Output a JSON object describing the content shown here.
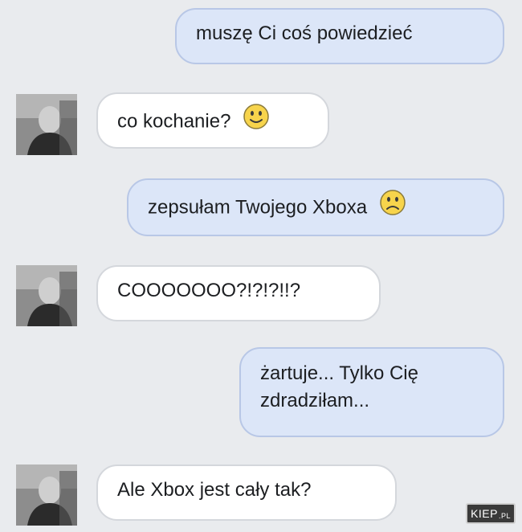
{
  "messages": [
    {
      "side": "out",
      "text": "muszę Ci coś powiedzieć",
      "emoji": ""
    },
    {
      "side": "in",
      "text": "co kochanie?",
      "emoji": "smile-emoji"
    },
    {
      "side": "out",
      "text": "zepsułam Twojego Xboxa",
      "emoji": "sad-emoji"
    },
    {
      "side": "in",
      "text": "COOOOOOO?!?!?!!?",
      "emoji": ""
    },
    {
      "side": "out",
      "text_line1": "żartuje... Tylko Cię",
      "text_line2": "zdradziłam...",
      "emoji": ""
    },
    {
      "side": "in",
      "text": "Ale Xbox jest cały tak?",
      "emoji": ""
    }
  ],
  "watermark": {
    "brand": "KIEP",
    "tld": ".PL"
  },
  "colors": {
    "background": "#e9ebee",
    "outgoing_bubble": "#dce6f8",
    "outgoing_border": "#b8c7e6",
    "incoming_bubble": "#ffffff",
    "incoming_border": "#d4d7dc",
    "emoji_fill": "#f7d44c"
  }
}
